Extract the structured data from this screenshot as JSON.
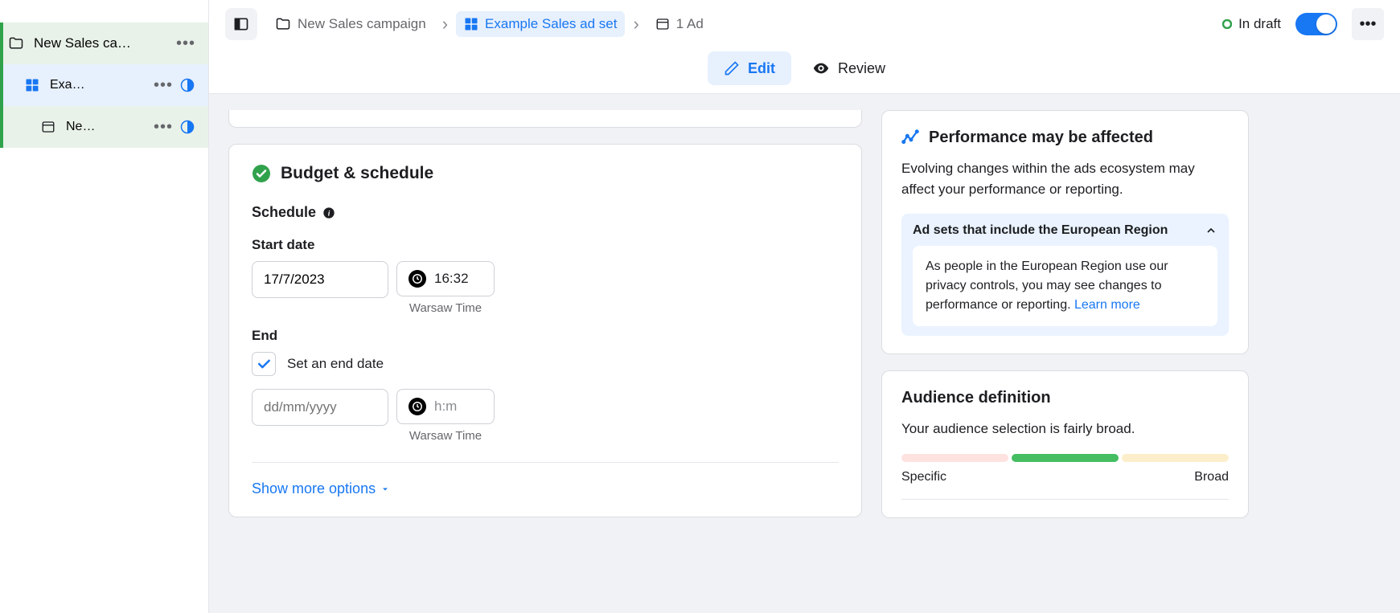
{
  "sidebar": {
    "items": [
      {
        "label": "New Sales ca…"
      },
      {
        "label": "Exa…"
      },
      {
        "label": "Ne…"
      }
    ]
  },
  "breadcrumb": {
    "campaign": "New Sales campaign",
    "adset": "Example Sales ad set",
    "ad": "1 Ad"
  },
  "header": {
    "status": "In draft"
  },
  "tabs": {
    "edit": "Edit",
    "review": "Review"
  },
  "budget": {
    "title": "Budget & schedule",
    "schedule_label": "Schedule",
    "start_date_label": "Start date",
    "start_date_value": "17/7/2023",
    "start_time_value": "16:32",
    "timezone": "Warsaw Time",
    "end_label": "End",
    "set_end_date": "Set an end date",
    "end_date_placeholder": "dd/mm/yyyy",
    "end_time_placeholder": "h:m",
    "show_more": "Show more options"
  },
  "performance": {
    "title": "Performance may be affected",
    "body": "Evolving changes within the ads ecosystem may affect your performance or reporting.",
    "notice_head": "Ad sets that include the European Region",
    "notice_body": "As people in the European Region use our privacy controls, you may see changes to performance or reporting. ",
    "learn_more": "Learn more"
  },
  "audience": {
    "title": "Audience definition",
    "body": "Your audience selection is fairly broad.",
    "specific": "Specific",
    "broad": "Broad"
  }
}
